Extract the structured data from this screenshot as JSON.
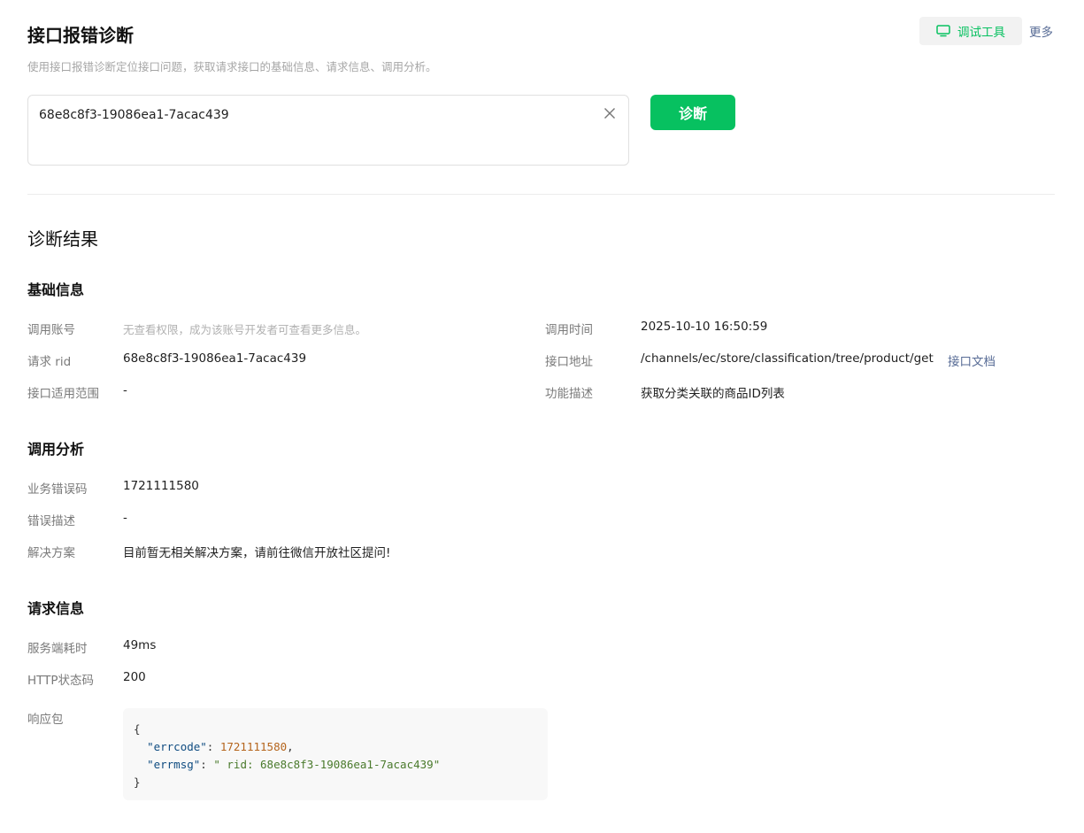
{
  "header": {
    "title": "接口报错诊断",
    "subtitle": "使用接口报错诊断定位接口问题，获取请求接口的基础信息、请求信息、调用分析。",
    "debug_tool_label": "调试工具",
    "more_label": "更多"
  },
  "search": {
    "rid_value": "68e8c8f3-19086ea1-7acac439",
    "diagnose_label": "诊断"
  },
  "result": {
    "title": "诊断结果",
    "basic": {
      "title": "基础信息",
      "account_label": "调用账号",
      "account_value": "无查看权限，成为该账号开发者可查看更多信息。",
      "rid_label": "请求 rid",
      "rid_value": "68e8c8f3-19086ea1-7acac439",
      "scope_label": "接口适用范围",
      "scope_value": "-",
      "time_label": "调用时间",
      "time_value": "2025-10-10 16:50:59",
      "url_label": "接口地址",
      "url_value": "/channels/ec/store/classification/tree/product/get",
      "doc_link": "接口文档",
      "desc_label": "功能描述",
      "desc_value": "获取分类关联的商品ID列表"
    },
    "analysis": {
      "title": "调用分析",
      "errcode_label": "业务错误码",
      "errcode_value": "1721111580",
      "errdesc_label": "错误描述",
      "errdesc_value": "-",
      "solution_label": "解决方案",
      "solution_value": "目前暂无相关解决方案，请前往微信开放社区提问!"
    },
    "request": {
      "title": "请求信息",
      "latency_label": "服务端耗时",
      "latency_value": "49ms",
      "http_label": "HTTP状态码",
      "http_value": "200",
      "response_label": "响应包",
      "response": {
        "open": "{",
        "errcode_key": "\"errcode\"",
        "errcode_val": "1721111580",
        "errmsg_key": "\"errmsg\"",
        "errmsg_val": "\" rid: 68e8c8f3-19086ea1-7acac439\"",
        "close": "}"
      }
    }
  },
  "colors": {
    "accent": "#07c160",
    "link": "#576b95"
  },
  "icons": {
    "debug_tool": "monitor-icon",
    "clear": "close-icon"
  }
}
